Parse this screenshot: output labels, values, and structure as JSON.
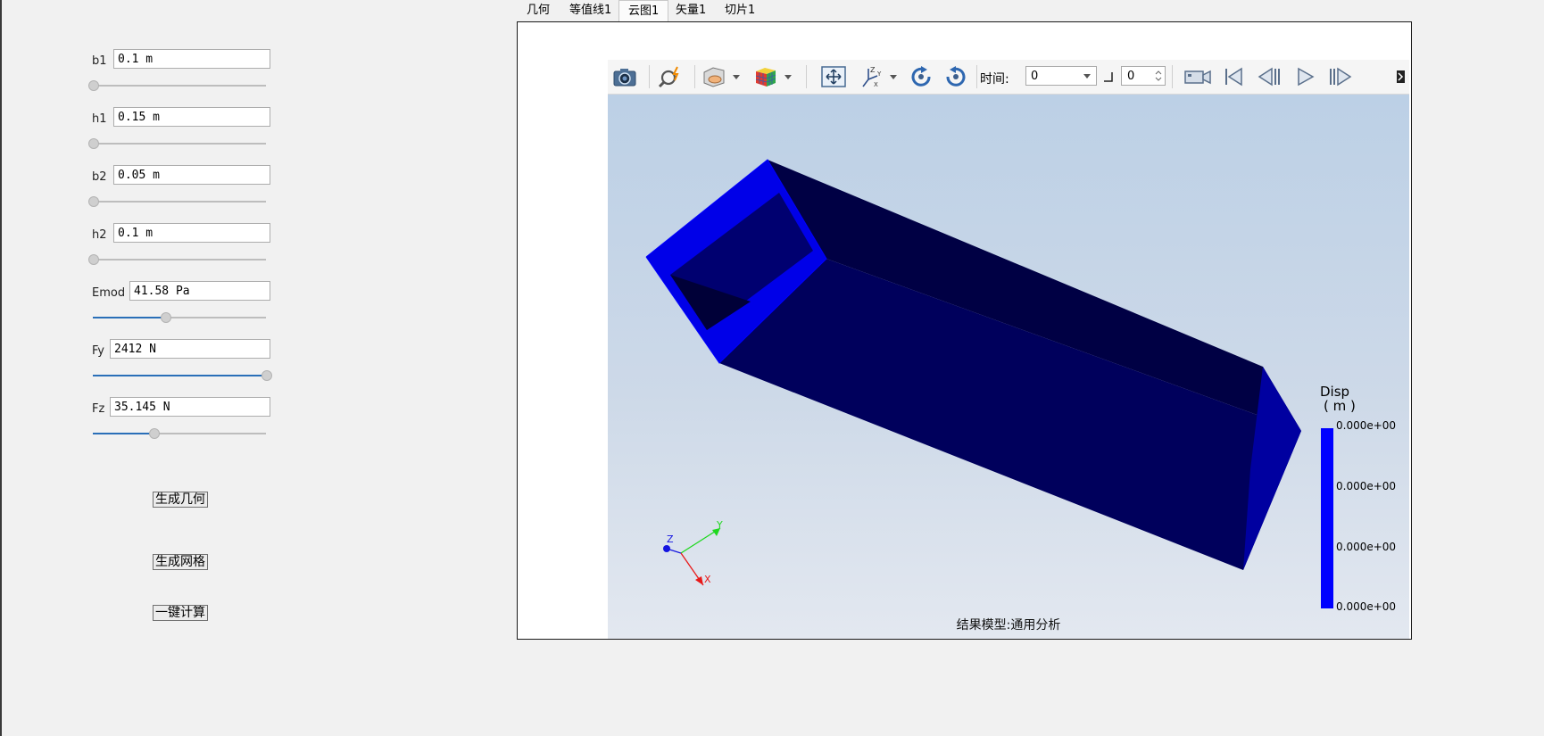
{
  "params": [
    {
      "id": "b1",
      "label": "b1",
      "value": "0.1 m",
      "slider": 0.0
    },
    {
      "id": "h1",
      "label": "h1",
      "value": "0.15 m",
      "slider": 0.0
    },
    {
      "id": "b2",
      "label": "b2",
      "value": "0.05 m",
      "slider": 0.0
    },
    {
      "id": "h2",
      "label": "h2",
      "value": "0.1 m",
      "slider": 0.0
    },
    {
      "id": "emod",
      "label": "Emod",
      "value": "41.58 Pa",
      "slider": 0.42
    },
    {
      "id": "fy",
      "label": "Fy",
      "value": "2412 N",
      "slider": 1.0
    },
    {
      "id": "fz",
      "label": "Fz",
      "value": "35.145 N",
      "slider": 0.35
    }
  ],
  "actions": {
    "gen_geometry": "生成几何",
    "gen_mesh": "生成网格",
    "one_click": "一键计算"
  },
  "tabs": [
    {
      "label": "几何",
      "active": false
    },
    {
      "label": "等值线1",
      "active": false
    },
    {
      "label": "云图1",
      "active": true
    },
    {
      "label": "矢量1",
      "active": false
    },
    {
      "label": "切片1",
      "active": false
    }
  ],
  "toolbar": {
    "time_label": "时间:",
    "time_value": "0",
    "step_value": "0",
    "icons": [
      "camera-icon",
      "probe-icon",
      "display-mode-icon",
      "colormap-cube-icon",
      "fit-view-icon",
      "axes-orientation-icon",
      "rotate-cw-icon",
      "rotate-ccw-icon",
      "record-video-icon",
      "first-frame-icon",
      "previous-frame-icon",
      "play-icon",
      "next-frame-icon",
      "toolbar-expand-icon"
    ]
  },
  "viewport": {
    "footer": "结果模型:通用分析",
    "axes": {
      "x": "X",
      "y": "Y",
      "z": "Z"
    },
    "legend": {
      "title": "Disp",
      "unit": "( m )",
      "values": [
        "0.000e+00",
        "0.000e+00",
        "0.000e+00",
        "0.000e+00"
      ],
      "color": "#0000ff"
    }
  },
  "colors": {
    "accent": "#2a6fb8",
    "beam_face": "#0000e8",
    "beam_dark": "#000044",
    "beam_mid": "#00005c"
  }
}
